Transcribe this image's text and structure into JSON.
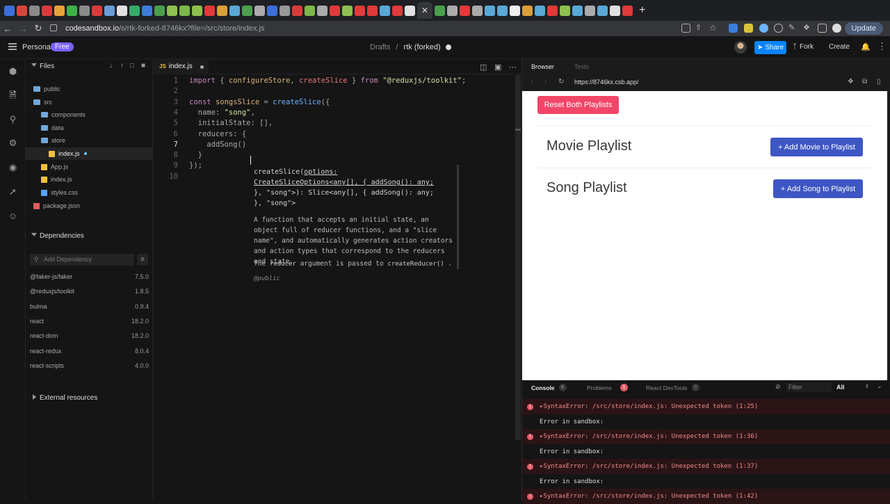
{
  "browser": {
    "url_host": "codesandbox.io",
    "url_path": "/s/rtk-forked-8746kx?file=/src/store/index.js",
    "update_label": "Update",
    "tab_favicon_colors": [
      "#3d6fd9",
      "#d9453d",
      "#8a8a8a",
      "#d83b3b",
      "#e9a23b",
      "#3db04b",
      "#8a8a8a",
      "#d83b3b",
      "#6b9cd6",
      "#e0e0e0",
      "#39a96b",
      "#3b7dd8",
      "#4a9f4d",
      "#8fbf4f",
      "#7cb84a",
      "#8fbf4f",
      "#e03a3a",
      "#d89f3b",
      "#59a8d6",
      "#4a9f4d",
      "#aaa",
      "#3d6fd9",
      "#999",
      "#d83b3b",
      "#7cb84a",
      "#aaa",
      "#e03a3a",
      "#8fbf4f",
      "#e03a3a",
      "#e03a3a",
      "#59a8d6",
      "#e03a3a",
      "#e0e0e0",
      "#4a9f4d",
      "#aaa",
      "#e03a3a",
      "#aaa",
      "#59a8d6",
      "#59a8d6",
      "#eee",
      "#d89f3b",
      "#59a8d6",
      "#e03a3a",
      "#8fbf4f",
      "#59a8d6",
      "#aaa",
      "#59a8d6",
      "#e0e0e0",
      "#e03a3a"
    ]
  },
  "header": {
    "workspace": "Personal",
    "plan": "Free",
    "breadcrumb_parent": "Drafts",
    "breadcrumb_sep": "/",
    "breadcrumb_current": "rtk (forked)",
    "share_label": "Share",
    "fork_label": "Fork",
    "create_label": "Create"
  },
  "explorer": {
    "title": "Files",
    "items": [
      {
        "label": "public",
        "type": "folder",
        "indent": 0
      },
      {
        "label": "src",
        "type": "folder",
        "indent": 0
      },
      {
        "label": "components",
        "type": "folder",
        "indent": 1
      },
      {
        "label": "data",
        "type": "folder",
        "indent": 1
      },
      {
        "label": "store",
        "type": "folder",
        "indent": 1
      },
      {
        "label": "index.js",
        "type": "js",
        "indent": 2,
        "active": true
      },
      {
        "label": "App.js",
        "type": "js",
        "indent": 1
      },
      {
        "label": "index.js",
        "type": "js",
        "indent": 1
      },
      {
        "label": "styles.css",
        "type": "css",
        "indent": 1
      },
      {
        "label": "package.json",
        "type": "json",
        "indent": 0
      }
    ],
    "dependencies_title": "Dependencies",
    "add_dependency_placeholder": "Add Dependency",
    "dependencies": [
      {
        "name": "@faker-js/faker",
        "version": "7.5.0"
      },
      {
        "name": "@reduxjs/toolkit",
        "version": "1.8.5"
      },
      {
        "name": "bulma",
        "version": "0.9.4"
      },
      {
        "name": "react",
        "version": "18.2.0"
      },
      {
        "name": "react-dom",
        "version": "18.2.0"
      },
      {
        "name": "react-redux",
        "version": "8.0.4"
      },
      {
        "name": "react-scripts",
        "version": "4.0.0"
      }
    ],
    "external_resources": "External resources"
  },
  "editor": {
    "tab_label": "index.js",
    "tab_badge": "JS",
    "current_line": 7,
    "line_numbers": [
      "1",
      "2",
      "3",
      "4",
      "5",
      "6",
      "7",
      "8",
      "9",
      "10"
    ],
    "tooltip": {
      "sig_line1": "createSlice(",
      "sig_line1_param": "options:",
      "sig_line2": "CreateSliceOptions<any[], { addSong(): any;",
      "sig_line3": "}, \"song\">): Slice<any[], { addSong(): any;",
      "sig_line4": "}, \"song\">",
      "description": "A function that accepts an initial state, an object full of reducer functions, and a \"slice name\", and automatically generates action creators and action types that correspond to the reducers and state.",
      "desc2_pre": "The",
      "desc2_code1": "reducer",
      "desc2_mid": "argument is passed to",
      "desc2_code2": "createReducer()",
      "desc2_post": ".",
      "public_tag": "@public"
    }
  },
  "preview": {
    "tab_browser": "Browser",
    "tab_tests": "Tests",
    "url": "https://8746kx.csb.app/",
    "reset_label": "Reset Both Playlists",
    "movie_title": "Movie Playlist",
    "movie_button": "+ Add Movie to Playlist",
    "song_title": "Song Playlist",
    "song_button": "+ Add Song to Playlist"
  },
  "console": {
    "tab_console": "Console",
    "console_count": "0",
    "tab_problems": "Problems",
    "problems_count": "1",
    "tab_devtools": "React DevTools",
    "devtools_count": "0",
    "filter_placeholder": "Filter",
    "level": "All",
    "entries": [
      {
        "kind": "error",
        "text": "SyntaxError: /src/store/index.js: Unexpected token (1:25)"
      },
      {
        "kind": "info",
        "text": "Error in sandbox:"
      },
      {
        "kind": "error",
        "text": "SyntaxError: /src/store/index.js: Unexpected token (1:36)"
      },
      {
        "kind": "info",
        "text": "Error in sandbox:"
      },
      {
        "kind": "error",
        "text": "SyntaxError: /src/store/index.js: Unexpected token (1:37)"
      },
      {
        "kind": "info",
        "text": "Error in sandbox:"
      },
      {
        "kind": "error",
        "text": "SyntaxError: /src/store/index.js: Unexpected token (1:42)"
      }
    ]
  },
  "code_tokens": {
    "l1": [
      [
        "kw",
        "import"
      ],
      [
        "pun",
        " { "
      ],
      [
        "prop",
        "configureStore"
      ],
      [
        "pun",
        ", "
      ],
      [
        "fn",
        "createSlice"
      ],
      [
        "pun",
        " } "
      ],
      [
        "kw",
        "from"
      ],
      [
        "pun",
        " "
      ],
      [
        "str",
        "\"@reduxjs/toolkit\""
      ],
      [
        "pun",
        ";"
      ]
    ],
    "l3": [
      [
        "kw",
        "const"
      ],
      [
        "pun",
        " "
      ],
      [
        "prop",
        "songsSlice"
      ],
      [
        "pun",
        " = "
      ],
      [
        "fnb",
        "createSlice"
      ],
      [
        "pun",
        "({"
      ]
    ],
    "l4": [
      [
        "pun",
        "  name: "
      ],
      [
        "str",
        "\"song\""
      ],
      [
        "pun",
        ","
      ]
    ],
    "l5": [
      [
        "pun",
        "  initialState: [],"
      ]
    ],
    "l6": [
      [
        "pun",
        "  reducers: {"
      ]
    ],
    "l7": [
      [
        "pun",
        "    addSong() "
      ]
    ],
    "l8": [
      [
        "pun",
        "  }"
      ]
    ],
    "l9": [
      [
        "pun",
        "});"
      ]
    ]
  }
}
